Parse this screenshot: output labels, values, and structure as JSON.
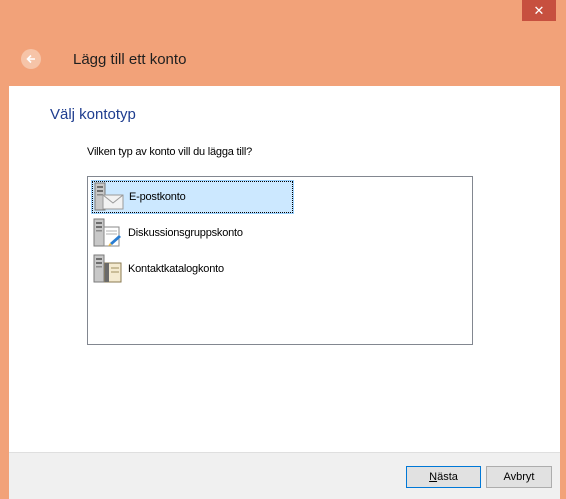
{
  "window": {
    "close_glyph": "✕",
    "header_title": "Lägg till ett konto",
    "back_icon": "back-arrow-icon"
  },
  "page": {
    "section_title": "Välj kontotyp",
    "question": "Vilken typ av konto vill du lägga till?"
  },
  "account_types": [
    {
      "label": "E-postkonto",
      "icon": "email-account-icon",
      "selected": true
    },
    {
      "label": "Diskussionsgruppskonto",
      "icon": "newsgroup-account-icon",
      "selected": false
    },
    {
      "label": "Kontaktkatalogkonto",
      "icon": "directory-account-icon",
      "selected": false
    }
  ],
  "buttons": {
    "next_first": "N",
    "next_rest": "ästa",
    "cancel": "Avbryt"
  },
  "colors": {
    "accent": "#f2a279",
    "close": "#c7503f",
    "title_text": "#1e3d8f",
    "selection": "#cce8ff"
  }
}
